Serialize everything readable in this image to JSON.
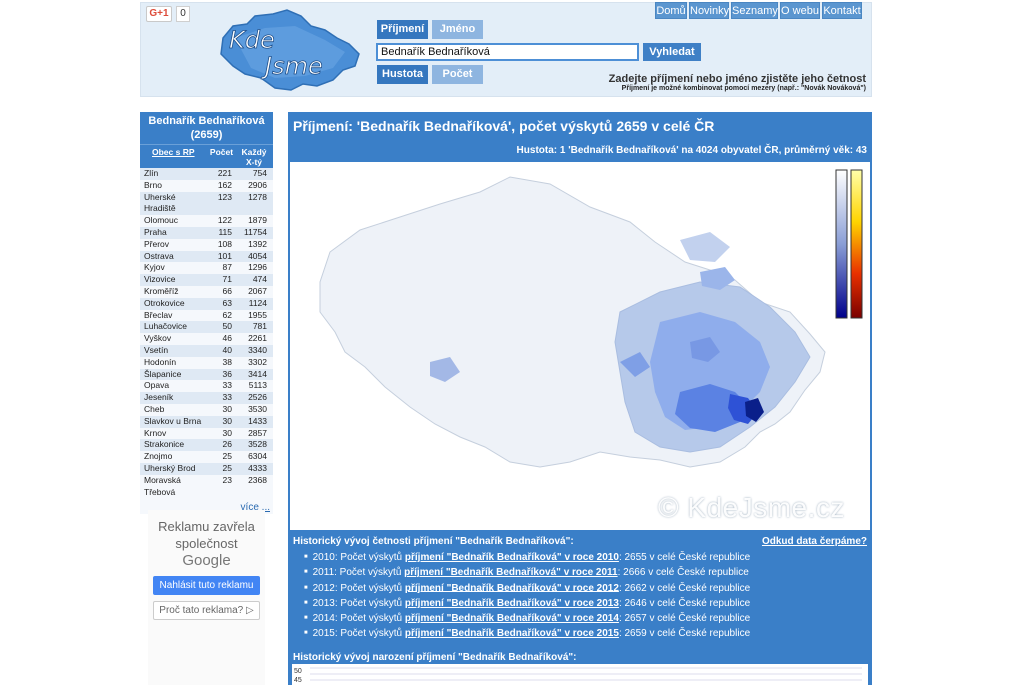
{
  "gplus": {
    "label": "G+1",
    "count": "0"
  },
  "logo": {
    "line1": "Kde",
    "line2": "Jsme"
  },
  "nav": [
    "Domů",
    "Novinky",
    "Seznamy",
    "O webu",
    "Kontakt"
  ],
  "tabs_top": {
    "surname": "Příjmení",
    "name": "Jméno"
  },
  "tabs_bottom": {
    "density": "Hustota",
    "count": "Počet"
  },
  "search": {
    "value": "Bednařík Bednaříková",
    "button": "Vyhledat"
  },
  "hint": {
    "line1": "Zadejte příjmení nebo jméno zjistěte jeho četnost",
    "line2": "Příjmení je možné kombinovat pomocí mezery (např.: \"Novák Nováková\")"
  },
  "left": {
    "title": "Bednařík Bednaříková",
    "total": "(2659)",
    "col_city": "Obec s RP",
    "col_count": "Počet",
    "col_every1": "Každý",
    "col_every2": "X-tý",
    "rows": [
      [
        "Zlín",
        "221",
        "754"
      ],
      [
        "Brno",
        "162",
        "2906"
      ],
      [
        "Uherské Hradiště",
        "123",
        "1278"
      ],
      [
        "Olomouc",
        "122",
        "1879"
      ],
      [
        "Praha",
        "115",
        "11754"
      ],
      [
        "Přerov",
        "108",
        "1392"
      ],
      [
        "Ostrava",
        "101",
        "4054"
      ],
      [
        "Kyjov",
        "87",
        "1296"
      ],
      [
        "Vizovice",
        "71",
        "474"
      ],
      [
        "Kroměříž",
        "66",
        "2067"
      ],
      [
        "Otrokovice",
        "63",
        "1124"
      ],
      [
        "Břeclav",
        "62",
        "1955"
      ],
      [
        "Luhačovice",
        "50",
        "781"
      ],
      [
        "Vyškov",
        "46",
        "2261"
      ],
      [
        "Vsetín",
        "40",
        "3340"
      ],
      [
        "Hodonín",
        "38",
        "3302"
      ],
      [
        "Šlapanice",
        "36",
        "3414"
      ],
      [
        "Opava",
        "33",
        "5113"
      ],
      [
        "Jeseník",
        "33",
        "2526"
      ],
      [
        "Cheb",
        "30",
        "3530"
      ],
      [
        "Slavkov u Brna",
        "30",
        "1433"
      ],
      [
        "Krnov",
        "30",
        "2857"
      ],
      [
        "Strakonice",
        "26",
        "3528"
      ],
      [
        "Znojmo",
        "25",
        "6304"
      ],
      [
        "Uherský Brod",
        "25",
        "4333"
      ],
      [
        "Moravská Třebová",
        "23",
        "2368"
      ]
    ],
    "more": "více ..."
  },
  "ad": {
    "text": "Reklamu zavřela společnost",
    "brand": "Google",
    "report": "Nahlásit tuto reklamu",
    "why": "Proč tato reklama? ▷"
  },
  "main": {
    "title": "Příjmení: 'Bednařík Bednaříková', počet výskytů 2659 v celé ČR",
    "density": "Hustota: 1 'Bednařík Bednaříková' na 4024 obyvatel ČR, průměrný věk: 43",
    "copyright": "© KdeJsme.cz"
  },
  "history": {
    "title": "Historický vývoj četnosti příjmení \"Bednařík Bednaříková\":",
    "source": "Odkud data čerpáme?",
    "items": [
      {
        "pre": "2010: Počet výskytů ",
        "link": "příjmení \"Bednařík Bednaříková\" v roce 2010",
        "post": ": 2655 v celé České republice"
      },
      {
        "pre": "2011: Počet výskytů ",
        "link": "příjmení \"Bednařík Bednaříková\" v roce 2011",
        "post": ": 2666 v celé České republice"
      },
      {
        "pre": "2012: Počet výskytů ",
        "link": "příjmení \"Bednařík Bednaříková\" v roce 2012",
        "post": ": 2662 v celé České republice"
      },
      {
        "pre": "2013: Počet výskytů ",
        "link": "příjmení \"Bednařík Bednaříková\" v roce 2013",
        "post": ": 2646 v celé České republice"
      },
      {
        "pre": "2014: Počet výskytů ",
        "link": "příjmení \"Bednařík Bednaříková\" v roce 2014",
        "post": ": 2657 v celé České republice"
      },
      {
        "pre": "2015: Počet výskytů ",
        "link": "příjmení \"Bednařík Bednaříková\" v roce 2015",
        "post": ": 2659 v celé České republice"
      }
    ],
    "births_title": "Historický vývoj narození příjmení \"Bednařík Bednaříková\":",
    "births_ticks": [
      "50",
      "45"
    ]
  },
  "colors": {
    "accent": "#3a7fc8",
    "header_bg": "#e3eef8"
  }
}
